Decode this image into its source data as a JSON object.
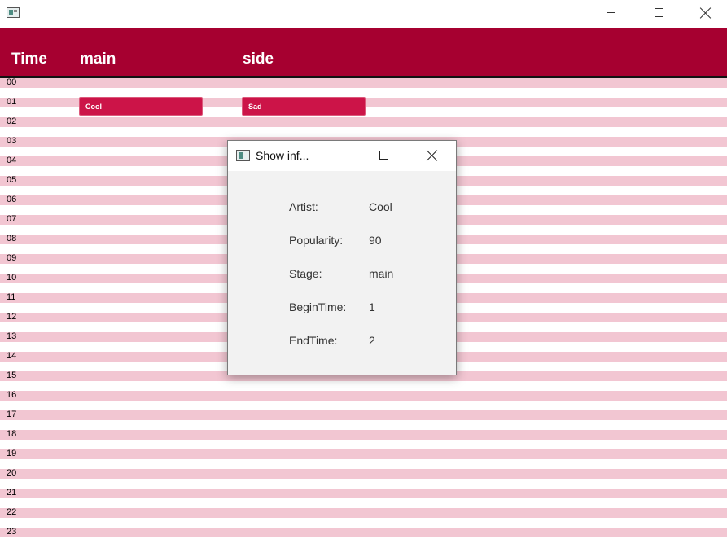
{
  "window": {
    "icon": "app-window-icon",
    "controls": {
      "minimize": "minimize-icon",
      "maximize": "maximize-icon",
      "close": "close-icon"
    }
  },
  "header": {
    "time_label": "Time",
    "stages": [
      "main",
      "side"
    ]
  },
  "schedule": {
    "hours": [
      "00",
      "01",
      "02",
      "03",
      "04",
      "05",
      "06",
      "07",
      "08",
      "09",
      "10",
      "11",
      "12",
      "13",
      "14",
      "15",
      "16",
      "17",
      "18",
      "19",
      "20",
      "21",
      "22",
      "23"
    ],
    "performances": [
      {
        "artist": "Cool",
        "stage": "main",
        "begin": 1
      },
      {
        "artist": "Sad",
        "stage": "side",
        "begin": 1
      }
    ]
  },
  "dialog": {
    "title": "Show inf...",
    "rows": [
      {
        "label": "Artist:",
        "value": "Cool"
      },
      {
        "label": "Popularity:",
        "value": "90"
      },
      {
        "label": "Stage:",
        "value": "main"
      },
      {
        "label": "BeginTime:",
        "value": "1"
      },
      {
        "label": "EndTime:",
        "value": "2"
      }
    ]
  },
  "colors": {
    "header": "#a60030",
    "band": "#f2c6d2",
    "slot": "#cc1448",
    "dialog_bg": "#f2f2f2"
  }
}
